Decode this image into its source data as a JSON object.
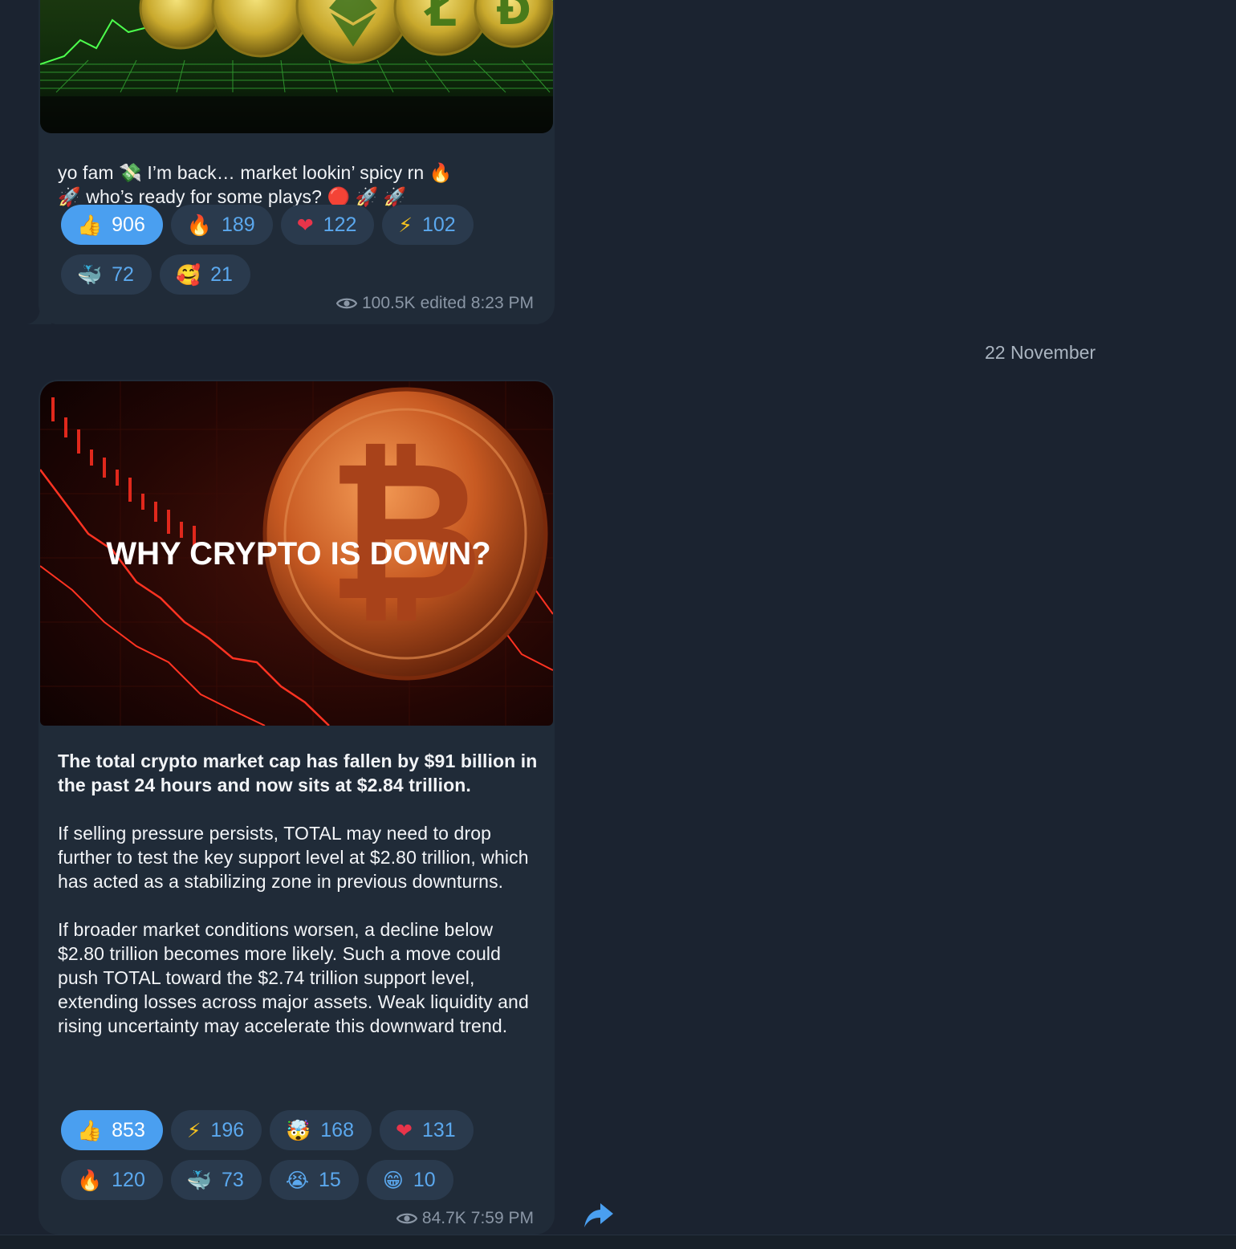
{
  "messages": [
    {
      "caption_line1": "yo fam 💸 I’m back… market lookin’ spicy rn 🔥",
      "caption_line2": "🚀 who’s ready for some plays? 🔴 🚀 🚀",
      "reactions": [
        {
          "emoji": "👍",
          "count": "906",
          "active": true
        },
        {
          "emoji": "🔥",
          "count": "189",
          "active": false
        },
        {
          "emoji": "❤",
          "count": "122",
          "active": false
        },
        {
          "emoji": "⚡",
          "count": "102",
          "active": false
        },
        {
          "emoji": "🐳",
          "count": "72",
          "active": false
        },
        {
          "emoji": "🥰",
          "count": "21",
          "active": false
        }
      ],
      "views": "100.5K",
      "edited": "edited",
      "time": "8:23 PM"
    },
    {
      "image_text": "WHY CRYPTO IS DOWN?",
      "lead": "The total crypto market cap has fallen by $91 billion in the past 24 hours and now sits at $2.84 trillion.",
      "paragraph2": "If selling pressure persists, TOTAL may need to drop further to test the key support level at $2.80 trillion, which has acted as a stabilizing zone in previous downturns.",
      "paragraph3": "If broader market conditions worsen, a decline below $2.80 trillion becomes more likely. Such a move could push TOTAL toward the $2.74 trillion support level, extending losses across major assets. Weak liquidity and rising uncertainty may accelerate this downward trend.",
      "reactions": [
        {
          "emoji": "👍",
          "count": "853",
          "active": true
        },
        {
          "emoji": "⚡",
          "count": "196",
          "active": false
        },
        {
          "emoji": "🤯",
          "count": "168",
          "active": false
        },
        {
          "emoji": "❤",
          "count": "131",
          "active": false
        },
        {
          "emoji": "🔥",
          "count": "120",
          "active": false
        },
        {
          "emoji": "🐳",
          "count": "73",
          "active": false
        },
        {
          "emoji": "😭",
          "count": "15",
          "active": false
        },
        {
          "emoji": "😁",
          "count": "10",
          "active": false
        }
      ],
      "views": "84.7K",
      "time": "7:59 PM"
    }
  ],
  "date_separator": "22 November",
  "icons": {
    "views": "eye-icon",
    "share": "share-arrow-icon"
  },
  "colors": {
    "background": "#1b2330",
    "bubble": "#202b38",
    "reaction_active": "#4a9ff0",
    "reaction_inactive": "#2a3a4d",
    "reaction_text": "#5ba8ee"
  }
}
